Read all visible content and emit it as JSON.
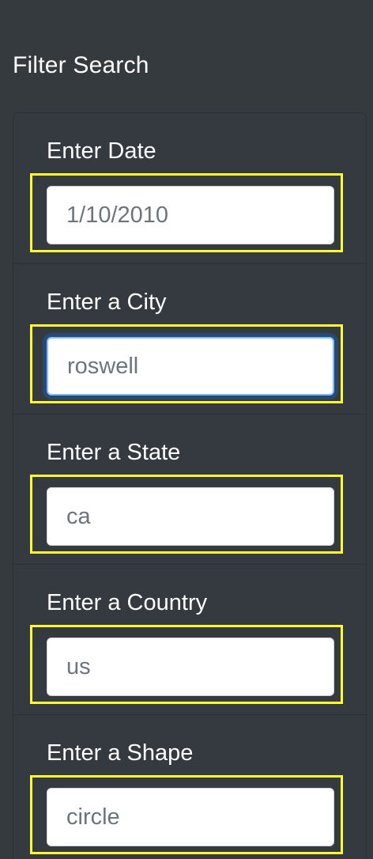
{
  "panel": {
    "title": "Filter Search"
  },
  "filters": [
    {
      "label": "Enter Date",
      "value": "1/10/2010"
    },
    {
      "label": "Enter a City",
      "value": "roswell"
    },
    {
      "label": "Enter a State",
      "value": "ca"
    },
    {
      "label": "Enter a Country",
      "value": "us"
    },
    {
      "label": "Enter a Shape",
      "value": "circle"
    }
  ],
  "colors": {
    "background": "#353a3f",
    "highlight": "#ffff33",
    "focus_ring": "#80bdff"
  }
}
